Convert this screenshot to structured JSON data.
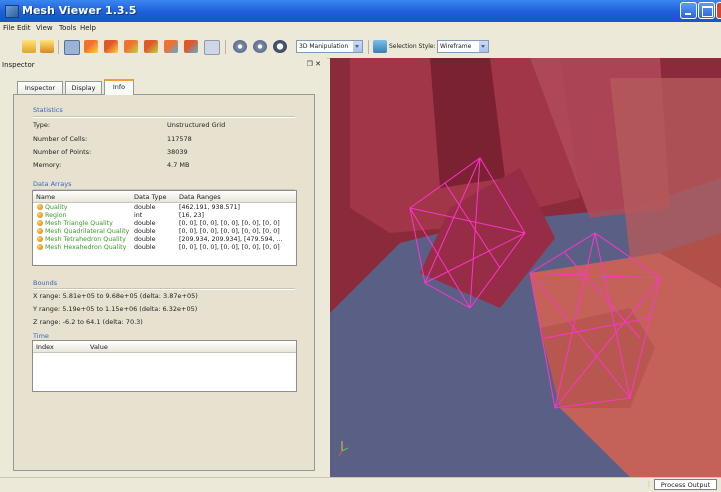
{
  "window": {
    "title": "Mesh Viewer 1.3.5"
  },
  "menu": [
    "File",
    "Edit",
    "View",
    "Tools",
    "Help"
  ],
  "toolbar": {
    "interaction_mode": "3D Manipulation",
    "selection_style_label": "Selection Style:",
    "selection_style_value": "Wireframe"
  },
  "inspector": {
    "title": "Inspector",
    "tabs": [
      "Inspector",
      "Display",
      "Info"
    ],
    "statistics": {
      "heading": "Statistics",
      "rows": [
        {
          "label": "Type:",
          "value": "Unstructured Grid"
        },
        {
          "label": "Number of Cells:",
          "value": "117578"
        },
        {
          "label": "Number of Points:",
          "value": "38039"
        },
        {
          "label": "Memory:",
          "value": "4.7 MB"
        }
      ]
    },
    "data_arrays": {
      "heading": "Data Arrays",
      "columns": [
        "Name",
        "Data Type",
        "Data Ranges"
      ],
      "rows": [
        {
          "name": "Quality",
          "type": "double",
          "range": "[462.191, 938.571]"
        },
        {
          "name": "Region",
          "type": "int",
          "range": "[16, 23]"
        },
        {
          "name": "Mesh Triangle Quality",
          "type": "double",
          "range": "[0, 0], [0, 0], [0, 0], [0, 0], [0, 0]"
        },
        {
          "name": "Mesh Quadrilateral Quality",
          "type": "double",
          "range": "[0, 0], [0, 0], [0, 0], [0, 0], [0, 0]"
        },
        {
          "name": "Mesh Tetrahedron Quality",
          "type": "double",
          "range": "[209.934, 209.934], [479.594, ..."
        },
        {
          "name": "Mesh Hexahedron Quality",
          "type": "double",
          "range": "[0, 0], [0, 0], [0, 0], [0, 0], [0, 0]"
        }
      ]
    },
    "bounds": {
      "heading": "Bounds",
      "rows": [
        "X range: 5.81e+05 to 9.68e+05 (delta: 3.87e+05)",
        "Y range: 5.19e+05 to 1.15e+06 (delta: 6.32e+05)",
        "Z range: -6.2 to 64.1 (delta: 70.3)"
      ]
    },
    "time": {
      "heading": "Time",
      "columns": [
        "Index",
        "Value"
      ]
    }
  },
  "status": {
    "process_output": "Process Output"
  },
  "colors": {
    "title_bar": "#1c5fd8",
    "view_background": "#5a6085",
    "surface_red": "#8a2a3a",
    "surface_salmon": "#c4625a",
    "selection_wireframe": "#ff33cc",
    "section_heading": "#3a63c0",
    "array_name": "#3a9a2a"
  }
}
